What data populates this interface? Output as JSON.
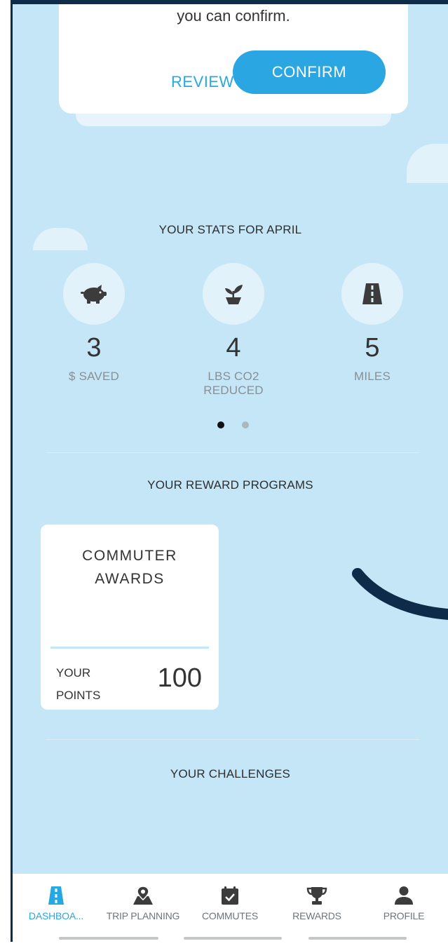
{
  "confirm_card": {
    "message": "you can confirm.",
    "review_label": "REVIEW",
    "confirm_label": "CONFIRM"
  },
  "stats": {
    "title": "YOUR STATS FOR APRIL",
    "items": [
      {
        "icon": "piggy-bank-icon",
        "value": "3",
        "label": "$ SAVED"
      },
      {
        "icon": "plant-icon",
        "value": "4",
        "label": "LBS CO2 REDUCED"
      },
      {
        "icon": "road-icon",
        "value": "5",
        "label": "MILES"
      }
    ],
    "page_indicator": {
      "pages": 2,
      "active": 0
    }
  },
  "rewards": {
    "title": "YOUR REWARD PROGRAMS",
    "card": {
      "name_line1": "COMMUTER",
      "name_line2": "AWARDS",
      "points_line1": "YOUR",
      "points_line2": "POINTS",
      "points_value": "100"
    }
  },
  "challenges": {
    "title": "YOUR CHALLENGES"
  },
  "tabbar": {
    "tabs": [
      {
        "label": "DASHBOA...",
        "icon": "road-icon",
        "active": true
      },
      {
        "label": "TRIP PLANNING",
        "icon": "map-pin-icon",
        "active": false
      },
      {
        "label": "COMMUTES",
        "icon": "calendar-check-icon",
        "active": false
      },
      {
        "label": "REWARDS",
        "icon": "trophy-icon",
        "active": false
      },
      {
        "label": "PROFILE",
        "icon": "user-icon",
        "active": false
      }
    ]
  },
  "colors": {
    "background": "#c4e6f7",
    "accent": "#2aa6e3",
    "annotation_arrow": "#0e2c4a"
  }
}
